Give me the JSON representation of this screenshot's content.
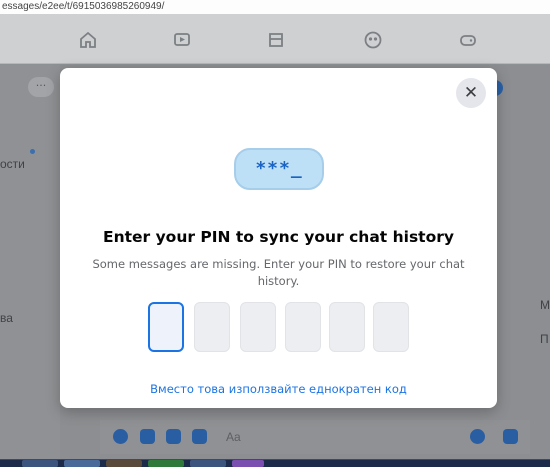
{
  "browser": {
    "url": "essages/e2ee/t/6915036985260949/"
  },
  "top_nav": {
    "icons": [
      "home-icon",
      "video-icon",
      "marketplace-icon",
      "groups-icon",
      "gaming-icon"
    ]
  },
  "background": {
    "left_labels": [
      "ости",
      "ва"
    ],
    "right_labels": [
      "М",
      "П"
    ],
    "more_label": "···",
    "composer_placeholder": "Aa"
  },
  "modal": {
    "close_symbol": "✕",
    "pin_illustration": "***_",
    "title": "Enter your PIN to sync your chat history",
    "subtitle": "Some messages are missing. Enter your PIN to restore your chat history.",
    "pin_length": 6,
    "alt_link": "Вместо това използвайте еднократен код"
  },
  "colors": {
    "accent": "#1b74e4",
    "overlay": "#8c8e91"
  }
}
